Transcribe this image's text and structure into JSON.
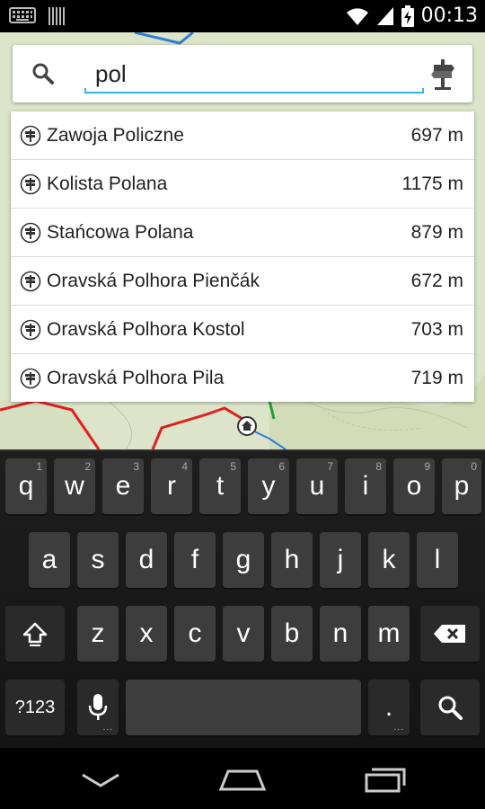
{
  "status_bar": {
    "time": "00:13",
    "icons": [
      "keyboard-icon",
      "barcode-icon",
      "wifi-icon",
      "signal-icon",
      "battery-charging-icon"
    ]
  },
  "search": {
    "query": "pol",
    "icon_left": "search-icon",
    "icon_right": "signpost-icon",
    "accent_color": "#33b5e5"
  },
  "results": [
    {
      "name": "Zawoja Policzne",
      "distance": "697 m"
    },
    {
      "name": "Kolista Polana",
      "distance": "1175 m"
    },
    {
      "name": "Stańcowa Polana",
      "distance": "879 m"
    },
    {
      "name": "Oravská Polhora Pienčák",
      "distance": "672 m"
    },
    {
      "name": "Oravská Polhora Kostol",
      "distance": "703 m"
    },
    {
      "name": "Oravská Polhora Pila",
      "distance": "719 m"
    }
  ],
  "keyboard": {
    "row1": [
      {
        "l": "q",
        "h": "1"
      },
      {
        "l": "w",
        "h": "2"
      },
      {
        "l": "e",
        "h": "3"
      },
      {
        "l": "r",
        "h": "4"
      },
      {
        "l": "t",
        "h": "5"
      },
      {
        "l": "y",
        "h": "6"
      },
      {
        "l": "u",
        "h": "7"
      },
      {
        "l": "i",
        "h": "8"
      },
      {
        "l": "o",
        "h": "9"
      },
      {
        "l": "p",
        "h": "0"
      }
    ],
    "row2": [
      "a",
      "s",
      "d",
      "f",
      "g",
      "h",
      "j",
      "k",
      "l"
    ],
    "row3": [
      "z",
      "x",
      "c",
      "v",
      "b",
      "n",
      "m"
    ],
    "symbols_label": "?123",
    "period_label": "."
  },
  "navbar": {
    "buttons": [
      "back-icon",
      "home-icon",
      "recent-apps-icon"
    ]
  }
}
